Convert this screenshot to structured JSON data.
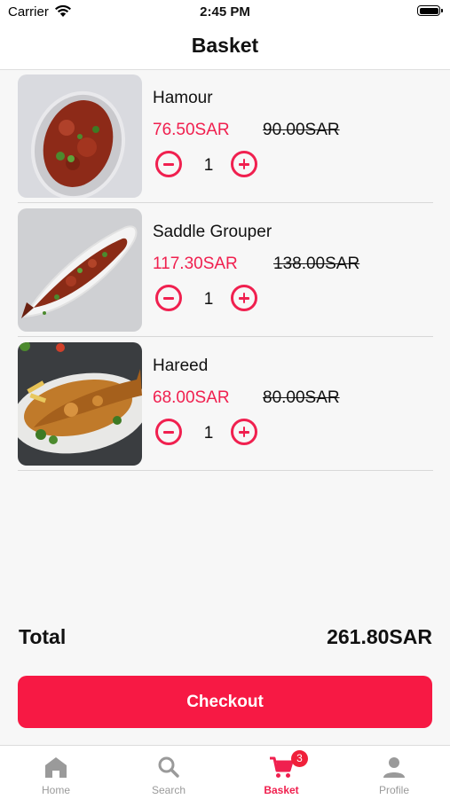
{
  "status_bar": {
    "carrier": "Carrier",
    "time": "2:45 PM"
  },
  "header": {
    "title": "Basket"
  },
  "basket": {
    "items": [
      {
        "name": "Hamour",
        "price": "76.50SAR",
        "old_price": "90.00SAR",
        "quantity": "1"
      },
      {
        "name": "Saddle Grouper",
        "price": "117.30SAR",
        "old_price": "138.00SAR",
        "quantity": "1"
      },
      {
        "name": "Hareed",
        "price": "68.00SAR",
        "old_price": "80.00SAR",
        "quantity": "1"
      }
    ]
  },
  "summary": {
    "total_label": "Total",
    "total_value": "261.80SAR"
  },
  "checkout": {
    "label": "Checkout"
  },
  "tabs": [
    {
      "label": "Home",
      "icon": "home-icon"
    },
    {
      "label": "Search",
      "icon": "search-icon"
    },
    {
      "label": "Basket",
      "icon": "cart-icon",
      "badge": "3",
      "active": true
    },
    {
      "label": "Profile",
      "icon": "person-icon"
    }
  ],
  "colors": {
    "accent": "#f0204f",
    "checkout": "#f71944",
    "inactive_tab": "#9a9a9a",
    "badge": "#f0203a"
  }
}
